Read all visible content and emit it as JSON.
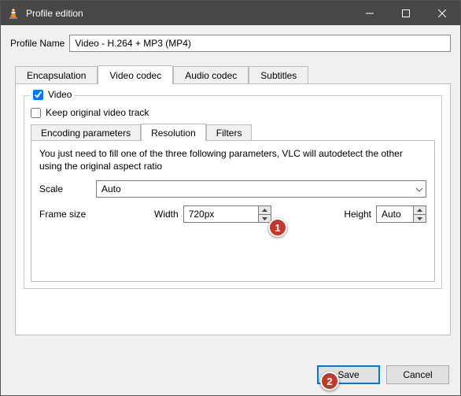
{
  "window": {
    "title": "Profile edition"
  },
  "profile_name": {
    "label": "Profile Name",
    "value": "Video - H.264 + MP3 (MP4)"
  },
  "tabs": {
    "encapsulation": "Encapsulation",
    "video_codec": "Video codec",
    "audio_codec": "Audio codec",
    "subtitles": "Subtitles"
  },
  "video_group": {
    "video_label": "Video",
    "keep_original_label": "Keep original video track"
  },
  "subtabs": {
    "encoding": "Encoding parameters",
    "resolution": "Resolution",
    "filters": "Filters"
  },
  "resolution": {
    "hint": "You just need to fill one of the three following parameters, VLC will autodetect the other using the original aspect ratio",
    "scale_label": "Scale",
    "scale_value": "Auto",
    "frame_size_label": "Frame size",
    "width_label": "Width",
    "width_value": "720px",
    "height_label": "Height",
    "height_value": "Auto"
  },
  "buttons": {
    "save": "Save",
    "cancel": "Cancel"
  },
  "callouts": {
    "one": "1",
    "two": "2"
  }
}
